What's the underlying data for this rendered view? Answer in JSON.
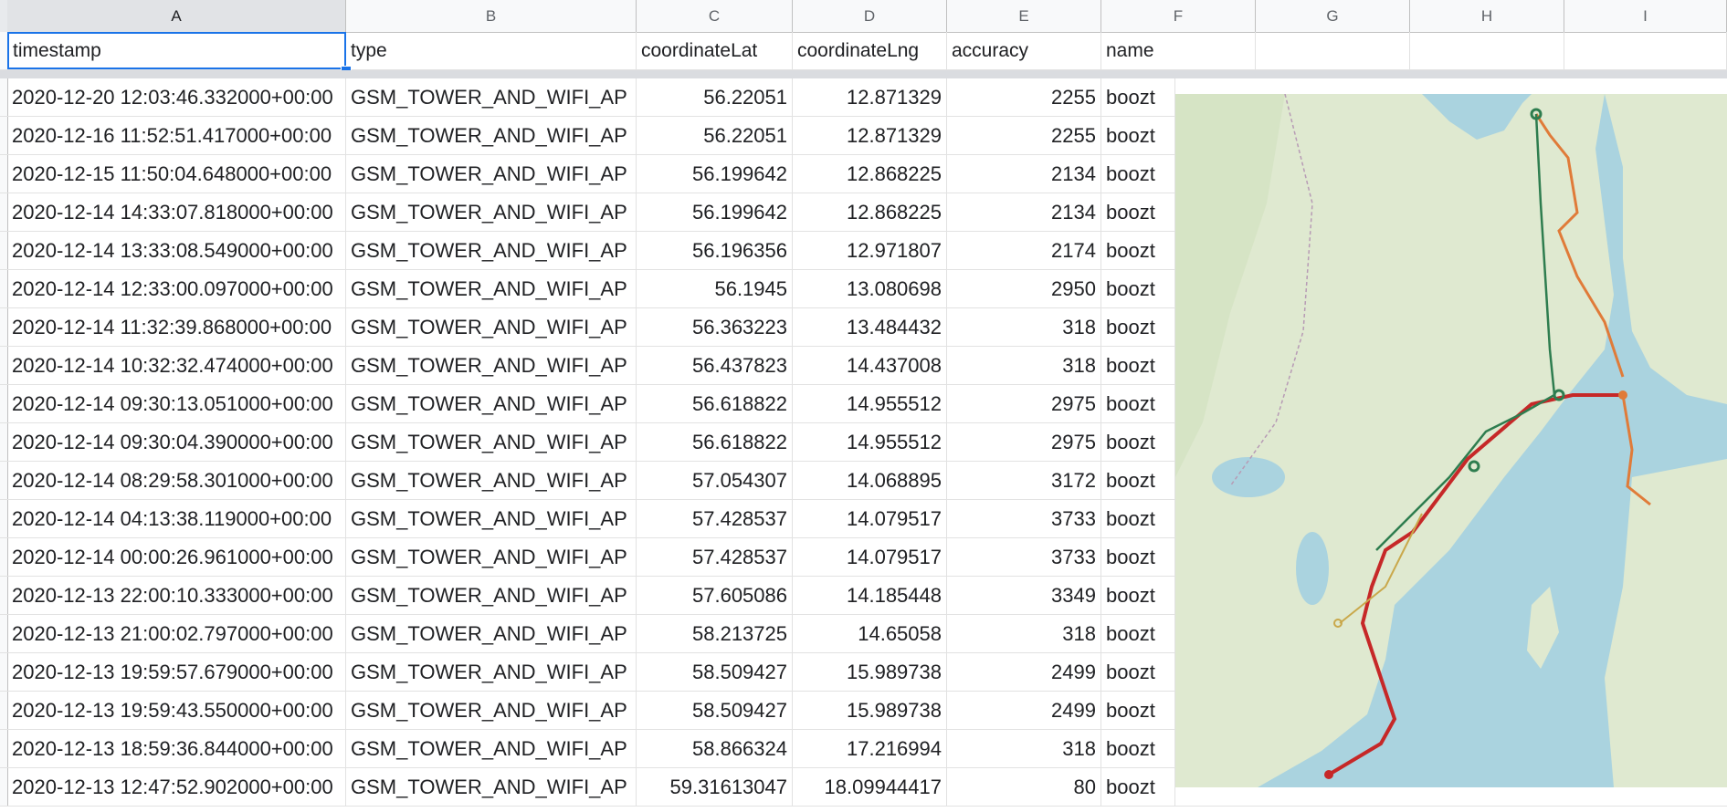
{
  "columns": [
    "A",
    "B",
    "C",
    "D",
    "E",
    "F",
    "G",
    "H",
    "I"
  ],
  "headers": {
    "timestamp": "timestamp",
    "type": "type",
    "lat": "coordinateLat",
    "lng": "coordinateLng",
    "accuracy": "accuracy",
    "name": "name"
  },
  "rows": [
    {
      "timestamp": "2020-12-20 12:03:46.332000+00:00",
      "type": "GSM_TOWER_AND_WIFI_AP",
      "lat": "56.22051",
      "lng": "12.871329",
      "accuracy": "2255",
      "name": "boozt"
    },
    {
      "timestamp": "2020-12-16 11:52:51.417000+00:00",
      "type": "GSM_TOWER_AND_WIFI_AP",
      "lat": "56.22051",
      "lng": "12.871329",
      "accuracy": "2255",
      "name": "boozt"
    },
    {
      "timestamp": "2020-12-15 11:50:04.648000+00:00",
      "type": "GSM_TOWER_AND_WIFI_AP",
      "lat": "56.199642",
      "lng": "12.868225",
      "accuracy": "2134",
      "name": "boozt"
    },
    {
      "timestamp": "2020-12-14 14:33:07.818000+00:00",
      "type": "GSM_TOWER_AND_WIFI_AP",
      "lat": "56.199642",
      "lng": "12.868225",
      "accuracy": "2134",
      "name": "boozt"
    },
    {
      "timestamp": "2020-12-14 13:33:08.549000+00:00",
      "type": "GSM_TOWER_AND_WIFI_AP",
      "lat": "56.196356",
      "lng": "12.971807",
      "accuracy": "2174",
      "name": "boozt"
    },
    {
      "timestamp": "2020-12-14 12:33:00.097000+00:00",
      "type": "GSM_TOWER_AND_WIFI_AP",
      "lat": "56.1945",
      "lng": "13.080698",
      "accuracy": "2950",
      "name": "boozt"
    },
    {
      "timestamp": "2020-12-14 11:32:39.868000+00:00",
      "type": "GSM_TOWER_AND_WIFI_AP",
      "lat": "56.363223",
      "lng": "13.484432",
      "accuracy": "318",
      "name": "boozt"
    },
    {
      "timestamp": "2020-12-14 10:32:32.474000+00:00",
      "type": "GSM_TOWER_AND_WIFI_AP",
      "lat": "56.437823",
      "lng": "14.437008",
      "accuracy": "318",
      "name": "boozt"
    },
    {
      "timestamp": "2020-12-14 09:30:13.051000+00:00",
      "type": "GSM_TOWER_AND_WIFI_AP",
      "lat": "56.618822",
      "lng": "14.955512",
      "accuracy": "2975",
      "name": "boozt"
    },
    {
      "timestamp": "2020-12-14 09:30:04.390000+00:00",
      "type": "GSM_TOWER_AND_WIFI_AP",
      "lat": "56.618822",
      "lng": "14.955512",
      "accuracy": "2975",
      "name": "boozt"
    },
    {
      "timestamp": "2020-12-14 08:29:58.301000+00:00",
      "type": "GSM_TOWER_AND_WIFI_AP",
      "lat": "57.054307",
      "lng": "14.068895",
      "accuracy": "3172",
      "name": "boozt"
    },
    {
      "timestamp": "2020-12-14 04:13:38.119000+00:00",
      "type": "GSM_TOWER_AND_WIFI_AP",
      "lat": "57.428537",
      "lng": "14.079517",
      "accuracy": "3733",
      "name": "boozt"
    },
    {
      "timestamp": "2020-12-14 00:00:26.961000+00:00",
      "type": "GSM_TOWER_AND_WIFI_AP",
      "lat": "57.428537",
      "lng": "14.079517",
      "accuracy": "3733",
      "name": "boozt"
    },
    {
      "timestamp": "2020-12-13 22:00:10.333000+00:00",
      "type": "GSM_TOWER_AND_WIFI_AP",
      "lat": "57.605086",
      "lng": "14.185448",
      "accuracy": "3349",
      "name": "boozt"
    },
    {
      "timestamp": "2020-12-13 21:00:02.797000+00:00",
      "type": "GSM_TOWER_AND_WIFI_AP",
      "lat": "58.213725",
      "lng": "14.65058",
      "accuracy": "318",
      "name": "boozt"
    },
    {
      "timestamp": "2020-12-13 19:59:57.679000+00:00",
      "type": "GSM_TOWER_AND_WIFI_AP",
      "lat": "58.509427",
      "lng": "15.989738",
      "accuracy": "2499",
      "name": "boozt"
    },
    {
      "timestamp": "2020-12-13 19:59:43.550000+00:00",
      "type": "GSM_TOWER_AND_WIFI_AP",
      "lat": "58.509427",
      "lng": "15.989738",
      "accuracy": "2499",
      "name": "boozt"
    },
    {
      "timestamp": "2020-12-13 18:59:36.844000+00:00",
      "type": "GSM_TOWER_AND_WIFI_AP",
      "lat": "58.866324",
      "lng": "17.216994",
      "accuracy": "318",
      "name": "boozt"
    },
    {
      "timestamp": "2020-12-13 12:47:52.902000+00:00",
      "type": "GSM_TOWER_AND_WIFI_AP",
      "lat": "59.31613047",
      "lng": "18.09944417",
      "accuracy": "80",
      "name": "boozt"
    }
  ],
  "colors": {
    "selection": "#1a73e8",
    "route_red": "#c62828",
    "route_orange": "#e07b39",
    "route_green": "#2e7d4f",
    "sea": "#aad3df",
    "land": "#dfe9d0"
  }
}
